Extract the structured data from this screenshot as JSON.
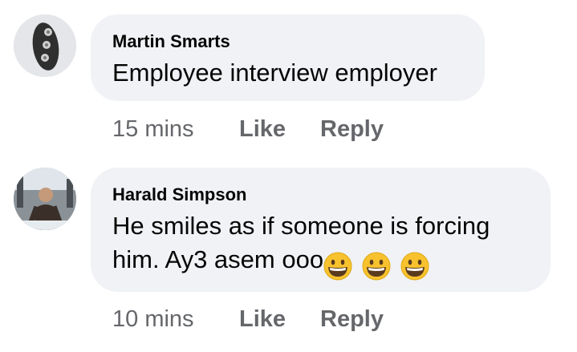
{
  "comments": [
    {
      "author": "Martin Smarts",
      "avatar_icon": "profile-photo",
      "text_lines": [
        "Employee interview employer"
      ],
      "time": "15 mins",
      "like_label": "Like",
      "reply_label": "Reply"
    },
    {
      "author": "Harald Simpson",
      "avatar_icon": "profile-photo",
      "text_lines": [
        "He smiles as if someone is forcing",
        "him.  Ay3 asem ooo"
      ],
      "emojis": [
        "grinning-face-emoji",
        "grinning-face-emoji",
        "grinning-face-emoji"
      ],
      "time": "10 mins",
      "like_label": "Like",
      "reply_label": "Reply"
    }
  ],
  "colors": {
    "bubble_bg": "#f0f2f5",
    "text": "#050505",
    "meta_text": "#65676b",
    "emoji_yellow": "#f7c22d"
  }
}
